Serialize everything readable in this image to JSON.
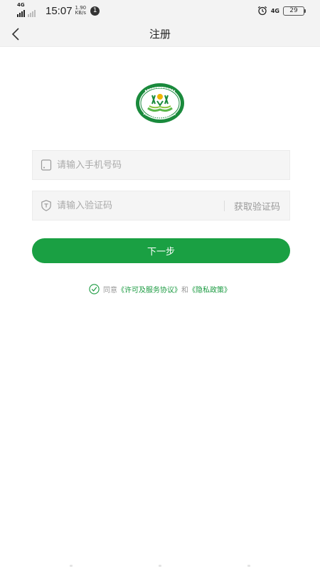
{
  "status_bar": {
    "network_left": "4G",
    "time": "15:07",
    "speed_value": "1.90",
    "speed_unit": "KB/s",
    "notification_count": "1",
    "network_right": "4G",
    "battery": "29"
  },
  "header": {
    "title": "注册"
  },
  "logo": {
    "icon": "college-emblem-logo",
    "color": "#1a8a3c"
  },
  "form": {
    "phone_placeholder": "请输入手机号码",
    "phone_value": "",
    "code_placeholder": "请输入验证码",
    "code_value": "",
    "get_code_label": "获取验证码",
    "next_label": "下一步"
  },
  "agreement": {
    "prefix": "同意",
    "license_link": "《许可及服务协议》",
    "conjunction": "和",
    "privacy_link": "《隐私政策》",
    "checked": true
  },
  "colors": {
    "accent": "#1aa043",
    "link": "#1a9a40",
    "header_bg": "#f3f3f3"
  }
}
